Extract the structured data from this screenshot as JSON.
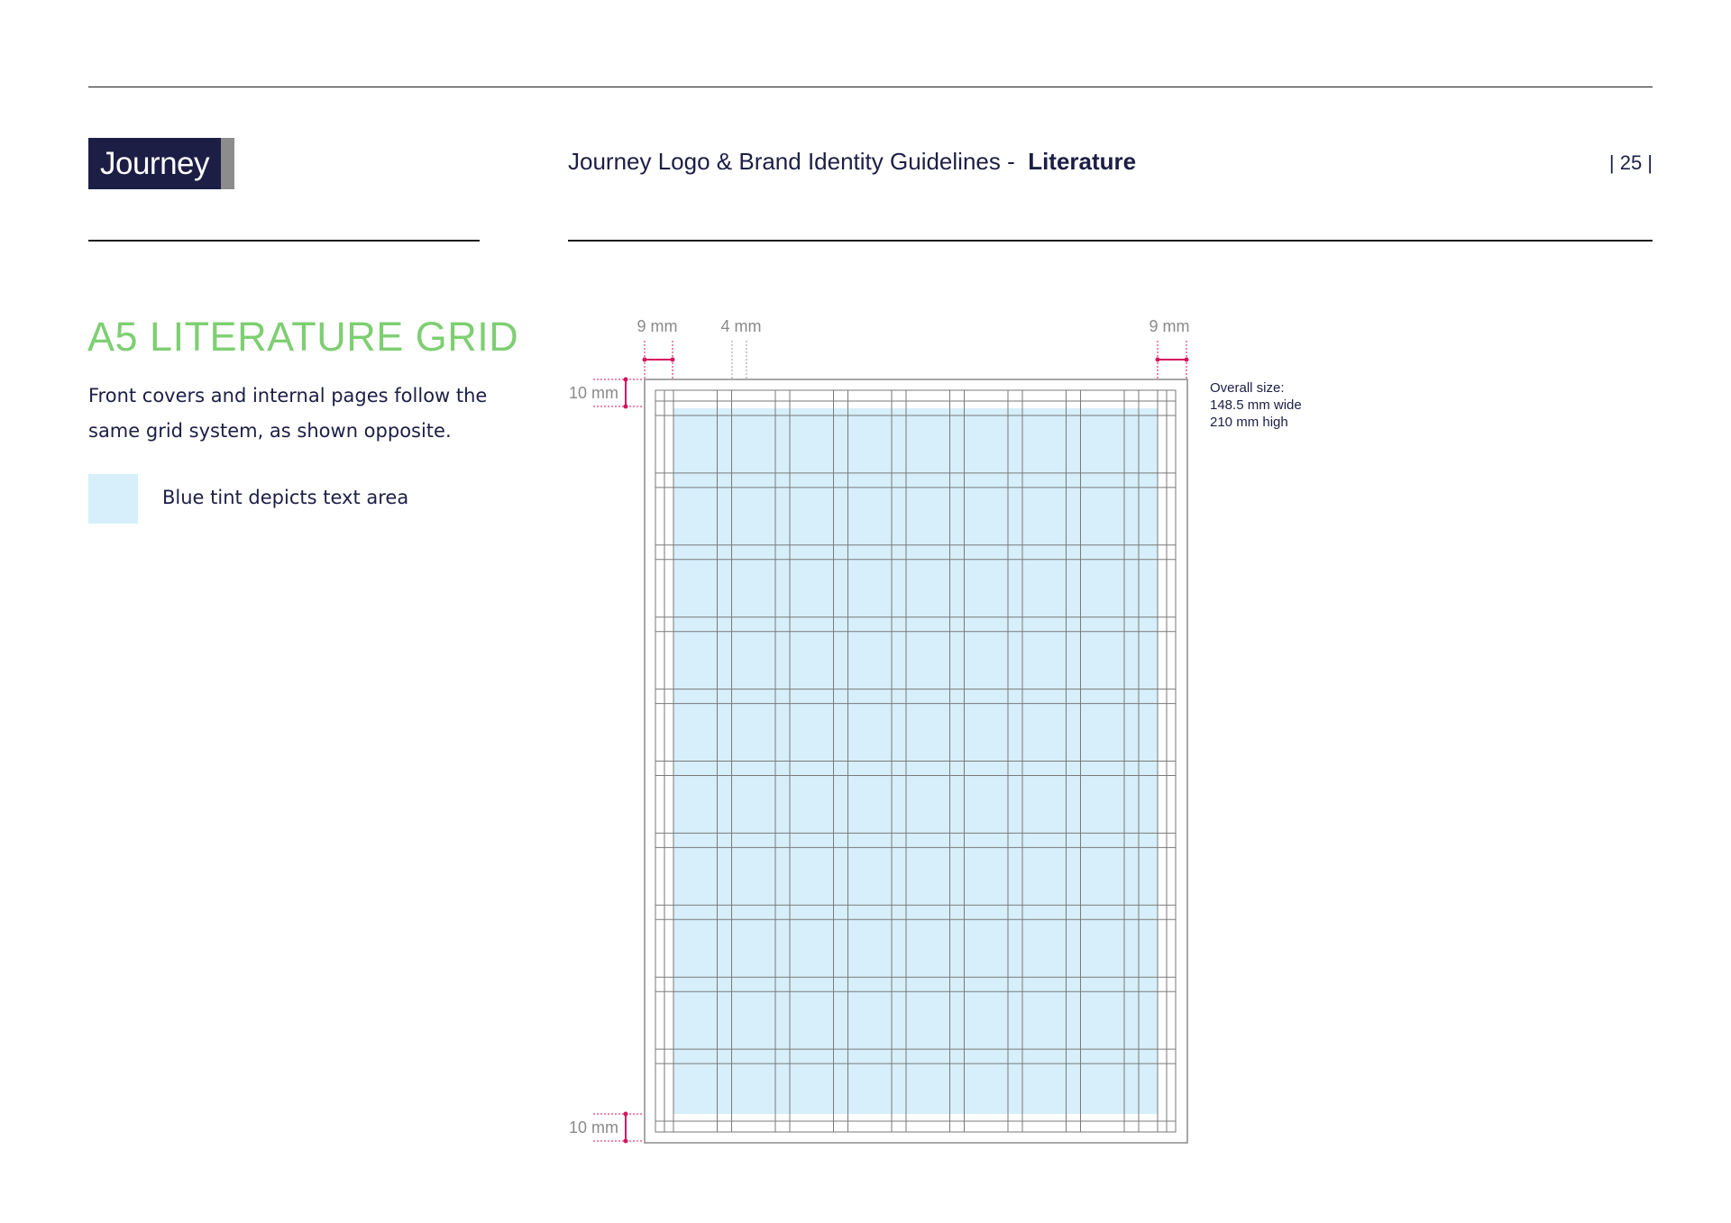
{
  "header": {
    "logo_text": "Journey",
    "title_prefix": "Journey Logo & Brand Identity Guidelines -",
    "title_section": "Literature",
    "page_number": "| 25 |"
  },
  "section": {
    "title": "A5 LITERATURE GRID",
    "body": "Front covers and internal pages follow the same grid system, as shown opposite.",
    "legend_label": "Blue tint depicts text area"
  },
  "diagram": {
    "dimensions": {
      "left_margin": "9 mm",
      "gutter": "4 mm",
      "right_margin": "9 mm",
      "top_margin": "10 mm",
      "bottom_margin": "10 mm"
    },
    "overall_size": [
      "Overall size:",
      "148.5 mm wide",
      "210 mm high"
    ],
    "columns": 9,
    "rows": 10
  },
  "colors": {
    "brand_navy": "#1c1e45",
    "heading_green": "#7ecf72",
    "text_area_tint": "#d6effa",
    "dimension_marker": "#d6145f",
    "grid_line": "#7a7a7a"
  }
}
